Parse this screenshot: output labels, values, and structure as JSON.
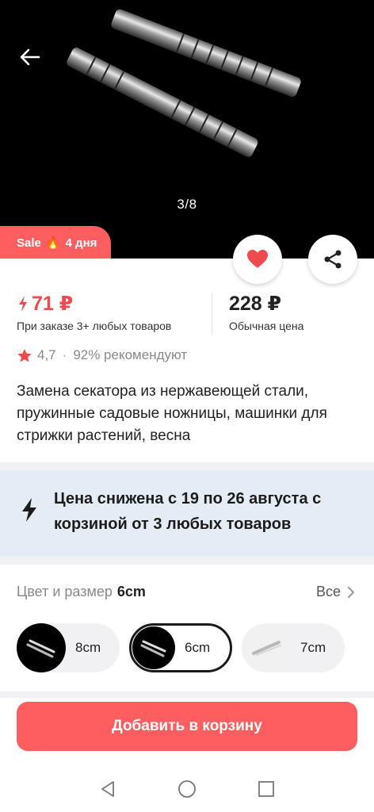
{
  "hero": {
    "image_counter": "3/8",
    "back_icon": "arrow-left-icon"
  },
  "sale_badge": {
    "label": "Sale",
    "flame": "🔥",
    "days": "4 дня"
  },
  "actions": {
    "favorite_icon": "heart-icon",
    "share_icon": "share-icon"
  },
  "price": {
    "bundle_price": "71 ₽",
    "bundle_note": "При заказе 3+ любых товаров",
    "regular_price": "228 ₽",
    "regular_note": "Обычная цена"
  },
  "rating": {
    "value": "4,7",
    "separator": "·",
    "recommend": "92% рекомендуют"
  },
  "product_title": "Замена секатора из нержавеющей стали, пружинные садовые ножницы, машинки для стрижки растений, весна",
  "promo": {
    "text": "Цена снижена с 19 по 26 августа с корзиной от 3 любых товаров"
  },
  "variants": {
    "heading": "Цвет и размер",
    "selected": "6cm",
    "all_label": "Все",
    "options": [
      {
        "label": "8cm"
      },
      {
        "label": "6cm"
      },
      {
        "label": "7cm"
      }
    ]
  },
  "cart_button": "Добавить в корзину",
  "colors": {
    "accent": "#ff5e60",
    "price_red": "#ef4b4f",
    "promo_bg": "#e6ecf6"
  }
}
